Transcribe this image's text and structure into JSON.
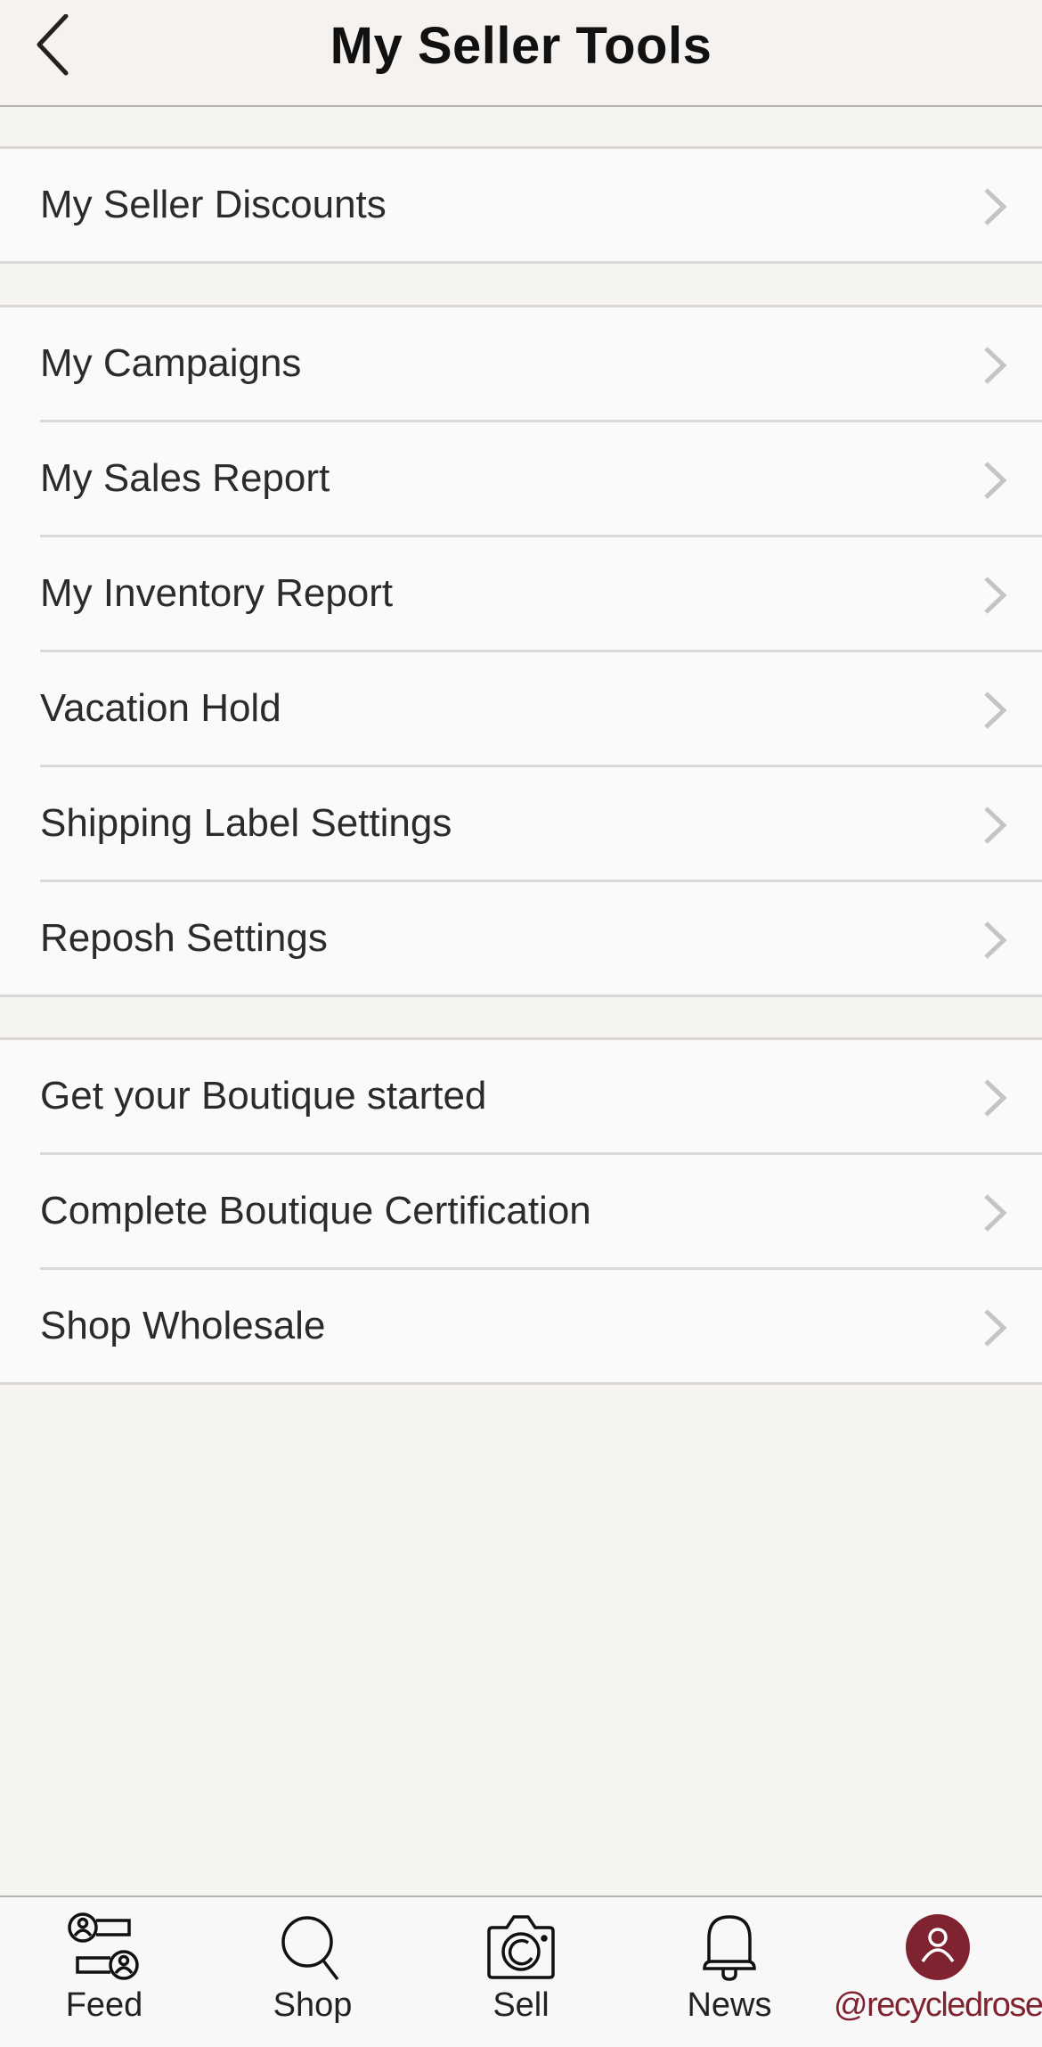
{
  "header": {
    "title": "My Seller Tools",
    "back_icon": "chevron-left-icon"
  },
  "sections": [
    {
      "items": [
        {
          "label": "My Seller Discounts"
        }
      ]
    },
    {
      "items": [
        {
          "label": "My Campaigns"
        },
        {
          "label": "My Sales Report"
        },
        {
          "label": "My Inventory Report"
        },
        {
          "label": "Vacation Hold"
        },
        {
          "label": "Shipping Label Settings"
        },
        {
          "label": "Reposh Settings"
        }
      ]
    },
    {
      "items": [
        {
          "label": "Get your Boutique started"
        },
        {
          "label": "Complete Boutique Certification"
        },
        {
          "label": "Shop Wholesale"
        }
      ]
    }
  ],
  "tabbar": {
    "tabs": [
      {
        "label": "Feed",
        "icon": "feed-icon"
      },
      {
        "label": "Shop",
        "icon": "search-icon"
      },
      {
        "label": "Sell",
        "icon": "camera-icon"
      },
      {
        "label": "News",
        "icon": "bell-icon"
      },
      {
        "label": "@recycledroses",
        "icon": "profile-avatar-icon",
        "active": true
      }
    ]
  },
  "colors": {
    "accent": "#7f2331",
    "background": "#f6f4f1",
    "row_background": "#fafafa",
    "divider": "#dad7d4",
    "chevron": "#c4c4c6"
  }
}
